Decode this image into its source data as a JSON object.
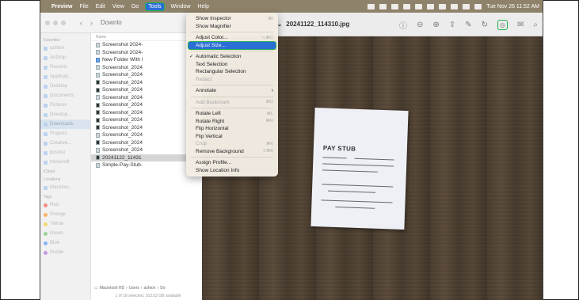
{
  "menubar": {
    "app": "Preview",
    "items": [
      "File",
      "Edit",
      "View",
      "Go",
      "Tools",
      "Window",
      "Help"
    ],
    "active": "Tools",
    "clock": "Tue Nov 26  11:52 AM"
  },
  "finder": {
    "title": "Downlo",
    "sidebar": {
      "favorites_label": "Favorites",
      "favorites": [
        "ashton",
        "AirDrop",
        "Recents",
        "Applicati...",
        "Desktop",
        "Documents",
        "Pictures",
        "Develop...",
        "Downloads",
        "Projects",
        "Creative...",
        "postnsi",
        "minecraft"
      ],
      "selected": "Downloads",
      "icloud_label": "iCloud",
      "locations_label": "Locations",
      "locations": [
        "Macintos..."
      ],
      "tags_label": "Tags",
      "tags": [
        {
          "name": "Red",
          "color": "#f28b82"
        },
        {
          "name": "Orange",
          "color": "#f7b36a"
        },
        {
          "name": "Yellow",
          "color": "#f5d76e"
        },
        {
          "name": "Green",
          "color": "#9cd49c"
        },
        {
          "name": "Blue",
          "color": "#8ab4f8"
        },
        {
          "name": "Purple",
          "color": "#c69ae0"
        }
      ]
    },
    "column_name": "Name",
    "files": [
      {
        "name": "Screenshot 2024-",
        "kind": "doc"
      },
      {
        "name": "Screenshot 2024-",
        "kind": "doc"
      },
      {
        "name": "New Folder With I",
        "kind": "folder"
      },
      {
        "name": "Screenshot_2024",
        "kind": "doc"
      },
      {
        "name": "Screenshot_2024",
        "kind": "doc"
      },
      {
        "name": "Screenshot_2024",
        "kind": "dark"
      },
      {
        "name": "Screenshot_2024",
        "kind": "dark"
      },
      {
        "name": "Screenshot_2024",
        "kind": "doc"
      },
      {
        "name": "Screenshot_2024",
        "kind": "dark"
      },
      {
        "name": "Screenshot_2024",
        "kind": "dark"
      },
      {
        "name": "Screenshot_2024",
        "kind": "dark"
      },
      {
        "name": "Screenshot_2024",
        "kind": "dark"
      },
      {
        "name": "Screenshot_2024",
        "kind": "doc"
      },
      {
        "name": "Screenshot_2024",
        "kind": "dark"
      },
      {
        "name": "Screenshot_2024",
        "kind": "doc"
      },
      {
        "name": "20241122_11431",
        "kind": "dark",
        "selected": true
      },
      {
        "name": "Simple-Pay-Stub-",
        "kind": "doc"
      }
    ],
    "path": [
      "Macintosh HD",
      "Users",
      "ashton",
      "Do"
    ],
    "status": "1 of 18 selected, 163.03 GB available"
  },
  "preview": {
    "filename": "20241122_114310.jpg",
    "paper_title": "PAY STUB"
  },
  "tools_menu": {
    "items": [
      {
        "label": "Show Inspector",
        "shortcut": "⌘I"
      },
      {
        "label": "Show Magnifier",
        "shortcut": ""
      },
      {
        "sep": true
      },
      {
        "label": "Adjust Color...",
        "shortcut": "⌥⌘C"
      },
      {
        "label": "Adjust Size...",
        "shortcut": "",
        "highlight": true
      },
      {
        "sep": true
      },
      {
        "label": "Automatic Selection",
        "shortcut": "",
        "checked": true
      },
      {
        "label": "Text Selection",
        "shortcut": ""
      },
      {
        "label": "Rectangular Selection",
        "shortcut": ""
      },
      {
        "label": "Redact",
        "shortcut": "",
        "disabled": true
      },
      {
        "sep": true
      },
      {
        "label": "Annotate",
        "shortcut": "",
        "submenu": true
      },
      {
        "sep": true
      },
      {
        "label": "Add Bookmark",
        "shortcut": "⌘D",
        "disabled": true
      },
      {
        "sep": true
      },
      {
        "label": "Rotate Left",
        "shortcut": "⌘L"
      },
      {
        "label": "Rotate Right",
        "shortcut": "⌘R"
      },
      {
        "label": "Flip Horizontal",
        "shortcut": ""
      },
      {
        "label": "Flip Vertical",
        "shortcut": ""
      },
      {
        "label": "Crop",
        "shortcut": "⌘K",
        "disabled": true
      },
      {
        "label": "Remove Background",
        "shortcut": "⇧⌘K"
      },
      {
        "sep": true
      },
      {
        "label": "Assign Profile...",
        "shortcut": ""
      },
      {
        "label": "Show Location Info",
        "shortcut": ""
      }
    ]
  }
}
